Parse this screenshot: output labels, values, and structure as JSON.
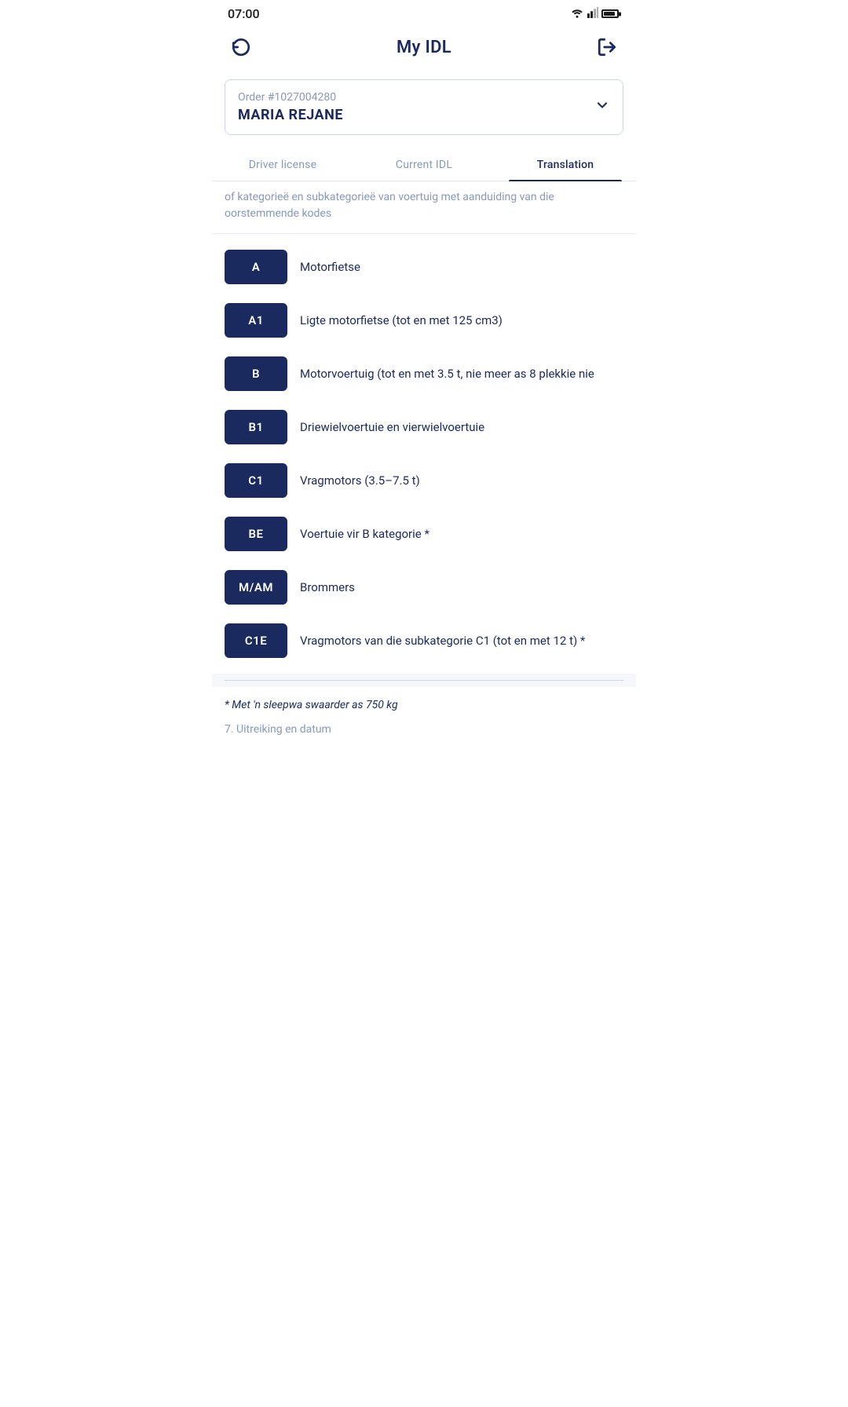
{
  "statusBar": {
    "time": "07:00",
    "wifi": "wifi",
    "signal": "signal",
    "battery": "battery"
  },
  "appBar": {
    "title": "My IDL",
    "refreshLabel": "refresh",
    "logoutLabel": "logout"
  },
  "order": {
    "number": "Order #1027004280",
    "name": "MARIA REJANE",
    "chevron": "▾"
  },
  "tabs": [
    {
      "id": "driver-license",
      "label": "Driver license",
      "active": false
    },
    {
      "id": "current-idl",
      "label": "Current IDL",
      "active": false
    },
    {
      "id": "translation",
      "label": "Translation",
      "active": true
    }
  ],
  "partialText": "of kategorieë en subkategorieë van voertuig met aanduiding van die oorstemmende kodes",
  "categories": [
    {
      "code": "A",
      "description": "Motorfietse"
    },
    {
      "code": "A1",
      "description": "Ligte motorfietse (tot en met 125 cm3)"
    },
    {
      "code": "B",
      "description": "Motorvoertuig (tot en met 3.5 t, nie meer as 8 plekkie nie"
    },
    {
      "code": "B1",
      "description": "Driewielvoertuie en vierwielvoertuie"
    },
    {
      "code": "C1",
      "description": "Vragmotors (3.5–7.5 t)"
    },
    {
      "code": "BE",
      "description": "Voertuie vir B kategorie *"
    },
    {
      "code": "M/AM",
      "description": "Brommers"
    },
    {
      "code": "C1E",
      "description": "Vragmotors van die subkategorie C1 (tot en met 12 t) *"
    }
  ],
  "footnote": "* Met 'n sleepwa swaarder as 750 kg",
  "partialBottom": "7. Uitreiking en datum"
}
